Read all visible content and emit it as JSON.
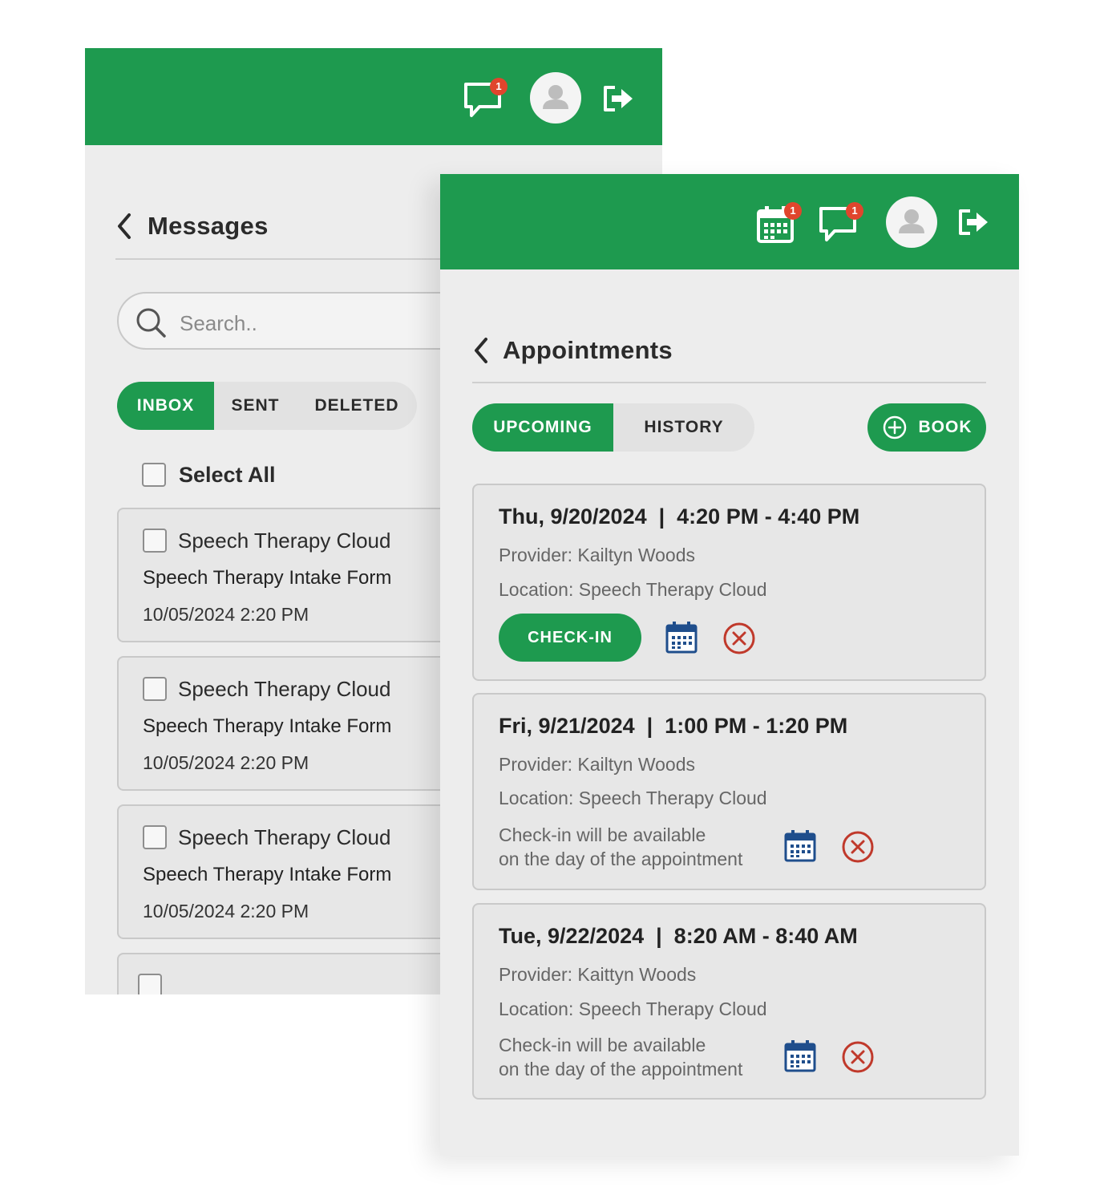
{
  "messages": {
    "header": {
      "chat_badge": "1",
      "icons": [
        "chat-icon",
        "user-avatar",
        "logout-icon"
      ]
    },
    "title": "Messages",
    "search_placeholder": "Search..",
    "tabs": [
      {
        "label": "INBOX",
        "active": true
      },
      {
        "label": "SENT",
        "active": false
      },
      {
        "label": "DELETED",
        "active": false
      }
    ],
    "select_all_label": "Select All",
    "items": [
      {
        "sender": "Speech Therapy Cloud",
        "subject": "Speech Therapy Intake Form",
        "date": "10/05/2024 2:20 PM"
      },
      {
        "sender": "Speech Therapy Cloud",
        "subject": "Speech Therapy Intake Form",
        "date": "10/05/2024 2:20 PM"
      },
      {
        "sender": "Speech Therapy Cloud",
        "subject": "Speech Therapy Intake Form",
        "date": "10/05/2024 2:20 PM"
      }
    ]
  },
  "appointments": {
    "header": {
      "calendar_badge": "1",
      "chat_badge": "1",
      "icons": [
        "calendar-icon",
        "chat-icon",
        "user-avatar",
        "logout-icon"
      ]
    },
    "title": "Appointments",
    "tabs": [
      {
        "label": "UPCOMING",
        "active": true
      },
      {
        "label": "HISTORY",
        "active": false
      }
    ],
    "book_label": "BOOK",
    "items": [
      {
        "datetime": "Thu, 9/20/2024  |  4:20 PM - 4:40 PM",
        "provider": "Provider: Kailtyn Woods",
        "location": "Location: Speech Therapy Cloud",
        "checkin_label": "CHECK-IN"
      },
      {
        "datetime": "Fri, 9/21/2024  |  1:00 PM - 1:20 PM",
        "provider": "Provider: Kailtyn Woods",
        "location": "Location: Speech Therapy Cloud",
        "checkin_note_line1": "Check-in will be available",
        "checkin_note_line2": "on the day of the appointment"
      },
      {
        "datetime": "Tue, 9/22/2024  |  8:20 AM - 8:40 AM",
        "provider": "Provider: Kaittyn Woods",
        "location": "Location: Speech Therapy Cloud",
        "checkin_note_line1": "Check-in will be available",
        "checkin_note_line2": "on the day of the appointment"
      }
    ]
  },
  "colors": {
    "brand_green": "#1e9a4f",
    "badge_red": "#e0452d",
    "cancel_red": "#c0392b",
    "calendar_blue": "#1f4e8c",
    "background": "#ededed"
  }
}
